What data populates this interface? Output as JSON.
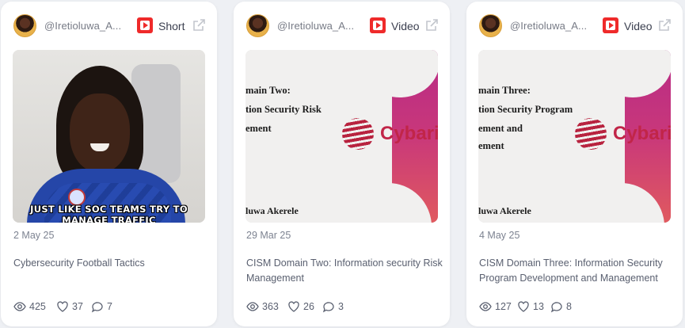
{
  "cards": [
    {
      "username": "@Iretioluwa_A...",
      "type": "Short",
      "date": "2 May 25",
      "title": "Cybersecurity Football Tactics",
      "views": "425",
      "likes": "37",
      "comments": "7",
      "caption_line1": "JUST LIKE SOC TEAMS TRY TO",
      "caption_line2": "MANAGE TRAFFIC"
    },
    {
      "username": "@Iretioluwa_A...",
      "type": "Video",
      "date": "29 Mar 25",
      "title": "CISM Domain Two: Information security Risk Management",
      "views": "363",
      "likes": "26",
      "comments": "3",
      "slide_line1": "main Two:",
      "slide_line2": "tion Security Risk",
      "slide_line3": "ement",
      "slide_author": "luwa Akerele",
      "slide_logo": "Cybaril"
    },
    {
      "username": "@Iretioluwa_A...",
      "type": "Video",
      "date": "4 May 25",
      "title": "CISM Domain Three: Information Security Program Development and Management",
      "views": "127",
      "likes": "13",
      "comments": "8",
      "slide_line1": "main Three:",
      "slide_line2": "tion Security Program",
      "slide_line3": "ement and",
      "slide_line4": "ement",
      "slide_author": "luwa Akerele",
      "slide_logo": "Cybaril"
    }
  ],
  "icons": {
    "platform": "youtube-icon",
    "external": "external-link-icon",
    "views": "eye-icon",
    "likes": "heart-icon",
    "comments": "comment-icon"
  },
  "colors": {
    "youtube_red": "#ef2a2a",
    "text_muted": "#7d8391",
    "card_bg": "#ffffff",
    "page_bg": "#eef0f4"
  }
}
